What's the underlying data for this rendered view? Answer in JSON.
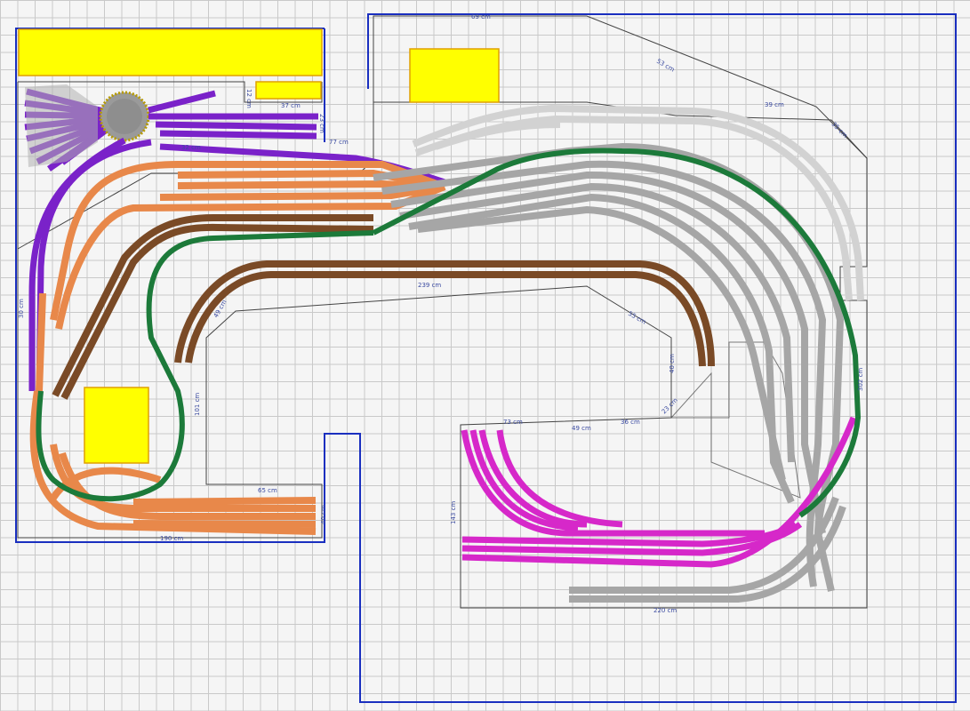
{
  "colors": {
    "grid": "#c9c9c9",
    "room_wall": "#1a2fbf",
    "outline": "#333333",
    "bench": "#ffff00",
    "bench_border": "#e0a000",
    "depot": "#7a22c9",
    "yard_orange": "#e8884a",
    "brown_loop": "#7a4a26",
    "mainline_green": "#1c7a3a",
    "grey_tracks": "#a6a6a6",
    "light_grey": "#d2d2d2",
    "magenta_yard": "#d628c9",
    "turntable": "#9a9a9a"
  },
  "dimensions": {
    "d1": "69 cm",
    "d2": "53 cm",
    "d3": "39 cm",
    "d4": "35 cm",
    "d5": "12 cm",
    "d6": "37 cm",
    "d7": "23 cm",
    "d8": "77 cm",
    "d9": "49 cm",
    "d10": "239 cm",
    "d11": "55 cm",
    "d12": "101 cm",
    "d13": "40 cm",
    "d14": "73 cm",
    "d15": "36 cm",
    "d16": "49 cm",
    "d17": "23 cm",
    "d18": "30 cm",
    "d19": "65 cm",
    "d20": "190 cm",
    "d21": "302 cm",
    "d22": "143 cm",
    "d23": "220 cm",
    "d24": "40 cm",
    "d25": "32 cm"
  }
}
